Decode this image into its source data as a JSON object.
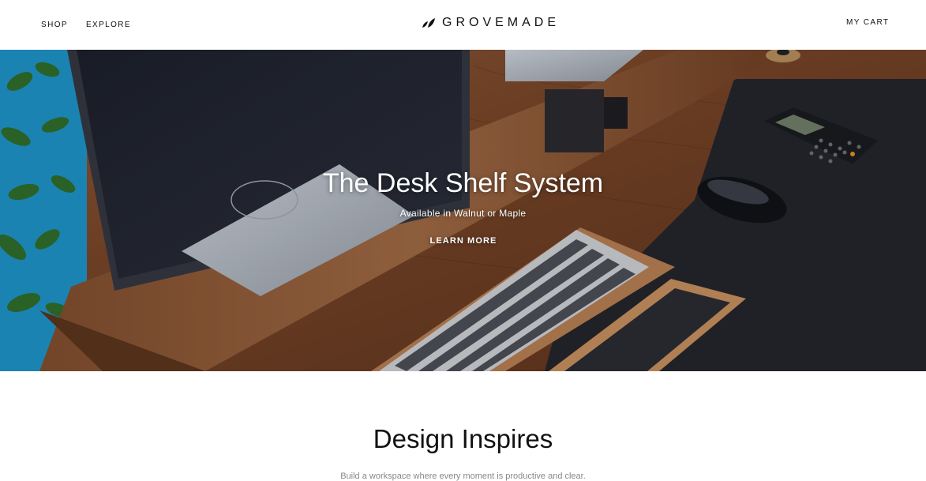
{
  "header": {
    "nav": [
      {
        "label": "SHOP"
      },
      {
        "label": "EXPLORE"
      }
    ],
    "brand": {
      "name": "GROVEMADE",
      "icon": "leaf-logo-icon"
    },
    "cart_label": "MY CART"
  },
  "hero": {
    "title": "The Desk Shelf System",
    "subtitle": "Available in Walnut or Maple",
    "cta_label": "LEARN MORE",
    "image": "desk-shelf-photo"
  },
  "section": {
    "title": "Design Inspires",
    "body": "Build a workspace where every moment is productive and clear."
  },
  "colors": {
    "walnut": "#7a4a2e",
    "mat": "#23242a",
    "plant_bg": "#1e8fc0",
    "text": "#111111"
  }
}
